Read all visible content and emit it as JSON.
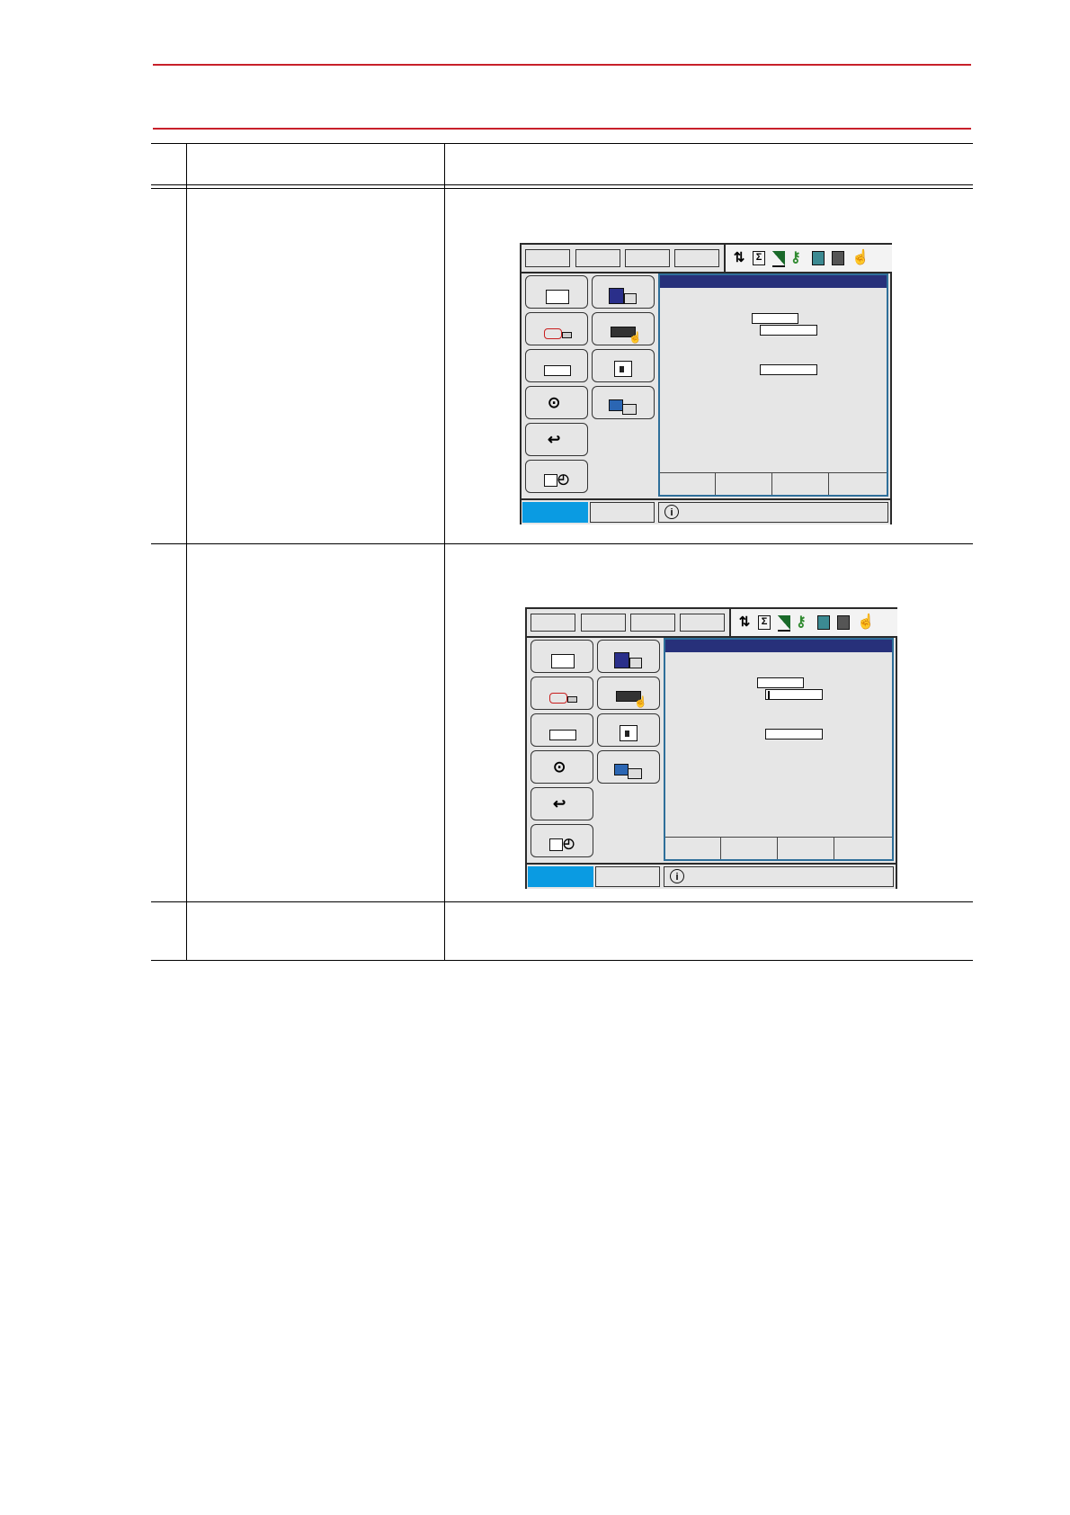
{
  "document": {
    "rule_color": "#c8202a",
    "table_rows": 3
  },
  "screens": [
    {
      "name": "screen-step-1",
      "field_cursor": false,
      "accent_colors": {
        "active_tab": "#0a9be2",
        "title_bar": "#27307a",
        "frame": "#2e6f9a"
      }
    },
    {
      "name": "screen-step-2",
      "field_cursor": true,
      "accent_colors": {
        "active_tab": "#0a9be2",
        "title_bar": "#27307a",
        "frame": "#2e6f9a"
      }
    }
  ],
  "icons": [
    "mode-icon",
    "sigma-icon",
    "signal-bars-icon",
    "keys-icon",
    "camera-icon",
    "edit-icon",
    "hand-icon",
    "info-icon"
  ]
}
